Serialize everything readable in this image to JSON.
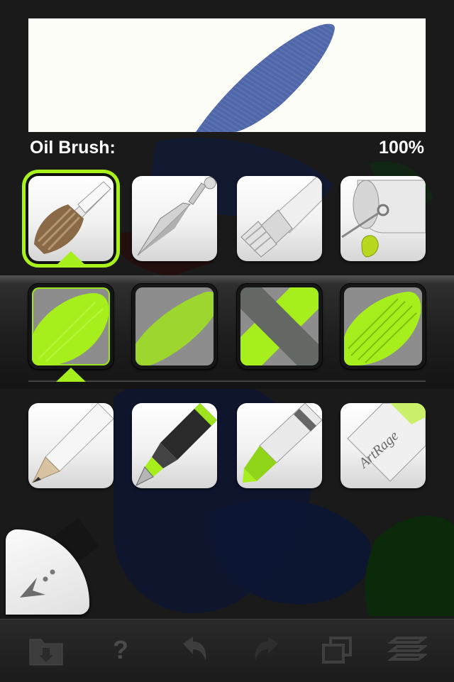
{
  "tool": {
    "name": "Oil Brush:",
    "opacity": "100%"
  },
  "colors": {
    "accent": "#a6ef1c",
    "paint_blue": "#4f67a8",
    "background": "#1a1a1a"
  },
  "tools": [
    {
      "name": "oil-brush",
      "selected": true
    },
    {
      "name": "palette-knife",
      "selected": false
    },
    {
      "name": "paint-tube",
      "selected": false
    },
    {
      "name": "paint-roller",
      "selected": false
    }
  ],
  "presets": [
    {
      "name": "preset-round-thick",
      "selected": true
    },
    {
      "name": "preset-dry-soft",
      "selected": false
    },
    {
      "name": "preset-flat-stroke",
      "selected": false
    },
    {
      "name": "preset-streaked",
      "selected": false
    }
  ],
  "more_tools": [
    {
      "name": "pencil"
    },
    {
      "name": "ink-pen"
    },
    {
      "name": "crayon"
    },
    {
      "name": "eraser",
      "brand_text": "ArtRage"
    }
  ],
  "toolbar": {
    "help_label": "?",
    "icons": [
      "folder-icon",
      "help-icon",
      "undo-icon",
      "redo-icon",
      "layers-stack-icon",
      "layers-icon"
    ]
  }
}
